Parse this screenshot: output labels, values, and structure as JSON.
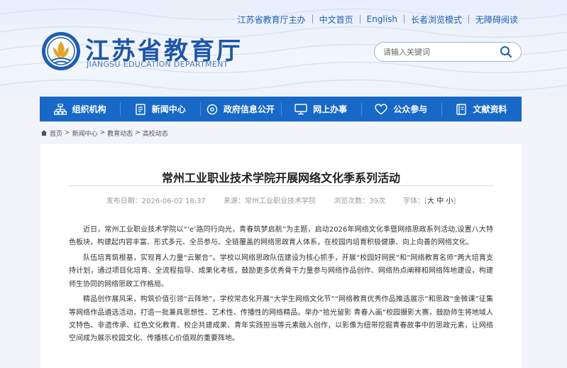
{
  "header": {
    "top_links": [
      "江苏省教育厅主办",
      "中文首页",
      "English",
      "长者浏览模式",
      "无障碍阅读"
    ],
    "title_cn": "江苏省教育厅",
    "title_en": "JIANGSU EDUCATION DEPARTMENT",
    "search_placeholder": "请输入关键词"
  },
  "nav": [
    {
      "label": "组织机构",
      "icon": "org-chart-icon"
    },
    {
      "label": "新闻中心",
      "icon": "document-icon"
    },
    {
      "label": "政府信息公开",
      "icon": "disc-icon"
    },
    {
      "label": "网上办事",
      "icon": "monitor-icon"
    },
    {
      "label": "公众参与",
      "icon": "heart-icon"
    },
    {
      "label": "文献资料",
      "icon": "book-icon"
    }
  ],
  "breadcrumb": [
    "首页",
    "新闻中心",
    "教育动态",
    "高校动态"
  ],
  "article": {
    "title": "常州工业职业技术学院开展网络文化季系列活动",
    "published": "发布日期：2026-06-02 18:37",
    "source": "来源：常州工业职业技术学院",
    "views": "浏览次数：39次",
    "font_size_label": "字体：[",
    "font_sizes": [
      "大",
      "中",
      "小"
    ],
    "font_size_close": "]",
    "paragraphs": [
      "近日，常州工业职业技术学院以“‘e’路同行向光，青春筑梦启航”为主题，启动2026年网络文化季暨网络思政系列活动,设置八大特色板块，构建起内容丰富、形式多元、全员参与、全链覆盖的网络思政育人体系，在校园内培育积极健康、向上向善的网络文化。",
      "队伍培育筑根基，实现育人力量“云聚合”。学校以网络思政队伍建设为核心抓手，开展“校园好网民”和“网络教育名师”两大培育支持计划，通过项目化培育、全流程指导、成果化考核，鼓励更多优秀骨干力量参与网络作品创作、网络热点阐释和网络阵地建设，构建师生协同的网络思政工作格局。",
      "精品创作展风采，构筑价值引领“云阵地”。学校常态化开展“大学生网络文化节”“网络教育优秀作品推选展示”和思政“金微课”征集等网络作品遴选活动，打造一批兼具思想性、艺术性、传播性的网络精品。举办“拾光留影 青春入画”校园摄影大赛，鼓励师生将地域人文特色、非遗传承、红色文化教育、校企共建成果、青年实践担当等元素融入创作，以影像为纽带挖掘青春故事中的思政元素，让网络空间成为展示校园文化、传播核心价值观的重要阵地。"
    ]
  },
  "colors": {
    "brand_blue": "#1768c7",
    "title_blue": "#1e56a8"
  }
}
